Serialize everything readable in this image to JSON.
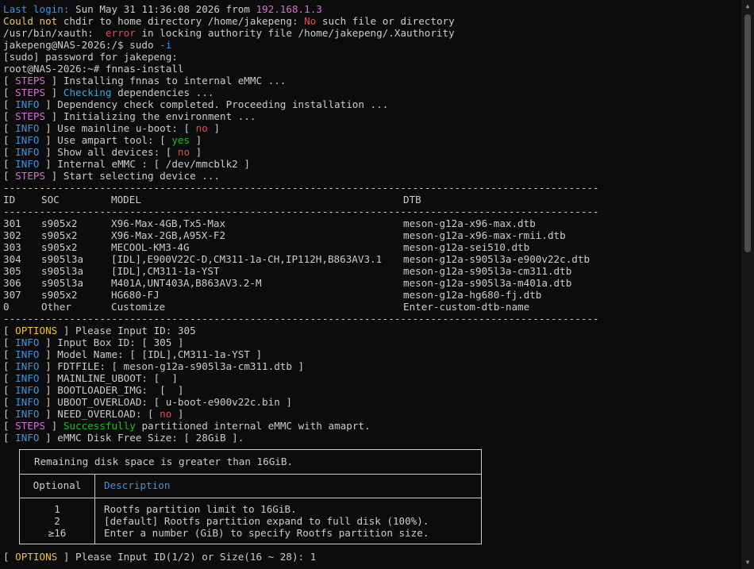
{
  "login": {
    "label": "Last login:",
    "text": " Sun May 31 11:36:08 2026 from ",
    "ip": "192.168.1.3"
  },
  "chdir": {
    "a": "Could not",
    "b": " chdir to home directory /home/jakepeng: ",
    "c": "No",
    "d": " such file or directory"
  },
  "xauth": {
    "a": "/usr/bin/xauth:  ",
    "b": "error",
    "c": " in locking authority file /home/jakepeng/.Xauthority"
  },
  "sudo_cmd": {
    "prompt": "jakepeng@NAS-2026:/$ sudo ",
    "flag": "-i"
  },
  "sudo_pw": "[sudo] password for jakepeng:",
  "root_cmd": "root@NAS-2026:~# fnnas-install",
  "log1": [
    {
      "tag": "STEPS",
      "color": "#d670d6",
      "pre": " Installing fnnas to internal eMMC ..."
    },
    {
      "tag": "STEPS",
      "color": "#d670d6",
      "hl": "Checking",
      "post": " dependencies ..."
    },
    {
      "tag": "INFO",
      "color": "#3a96dd",
      "pre": " Dependency check completed. Proceeding installation ..."
    },
    {
      "tag": "STEPS",
      "color": "#d670d6",
      "pre": " Initializing the environment ..."
    },
    {
      "tag": "INFO",
      "color": "#3a96dd",
      "pre": " Use mainline u-boot: [ ",
      "val": "no",
      "valc": "#e74856",
      "end": " ]"
    },
    {
      "tag": "INFO",
      "color": "#3a96dd",
      "pre": " Use ampart tool: [ ",
      "val": "yes",
      "valc": "#16c60c",
      "end": " ]"
    },
    {
      "tag": "INFO",
      "color": "#3a96dd",
      "pre": " Show all devices: [ ",
      "val": "no",
      "valc": "#e74856",
      "end": " ]"
    },
    {
      "tag": "INFO",
      "color": "#3a96dd",
      "pre": " Internal eMMC : [ /dev/mmcblk2 ]"
    },
    {
      "tag": "STEPS",
      "color": "#d670d6",
      "pre": " Start selecting device ..."
    }
  ],
  "dashes": "---------------------------------------------------------------------------------------------------",
  "table": {
    "headers": [
      "ID",
      "SOC",
      "MODEL",
      "DTB"
    ],
    "rows": [
      [
        "301",
        "s905x2",
        "X96-Max-4GB,Tx5-Max",
        "meson-g12a-x96-max.dtb"
      ],
      [
        "302",
        "s905x2",
        "X96-Max-2GB,A95X-F2",
        "meson-g12a-x96-max-rmii.dtb"
      ],
      [
        "303",
        "s905x2",
        "MECOOL-KM3-4G",
        "meson-g12a-sei510.dtb"
      ],
      [
        "304",
        "s905l3a",
        "[IDL],E900V22C-D,CM311-1a-CH,IP112H,B863AV3.1",
        "meson-g12a-s905l3a-e900v22c.dtb"
      ],
      [
        "305",
        "s905l3a",
        "[IDL],CM311-1a-YST",
        "meson-g12a-s905l3a-cm311.dtb"
      ],
      [
        "306",
        "s905l3a",
        "M401A,UNT403A,B863AV3.2-M",
        "meson-g12a-s905l3a-m401a.dtb"
      ],
      [
        "307",
        "s905x2",
        "HG680-FJ",
        "meson-g12a-hg680-fj.dtb"
      ],
      [
        "0",
        "Other",
        "Customize",
        "Enter-custom-dtb-name"
      ]
    ]
  },
  "log2": [
    {
      "tag": "OPTIONS",
      "color": "#f1c232",
      "pre": " Please Input ID: 305"
    },
    {
      "tag": "INFO",
      "color": "#3a96dd",
      "pre": " Input Box ID: [ 305 ]"
    },
    {
      "tag": "INFO",
      "color": "#3a96dd",
      "pre": " Model Name: [ [IDL],CM311-1a-YST ]"
    },
    {
      "tag": "INFO",
      "color": "#3a96dd",
      "pre": " FDTFILE: [ meson-g12a-s905l3a-cm311.dtb ]"
    },
    {
      "tag": "INFO",
      "color": "#3a96dd",
      "pre": " MAINLINE_UBOOT: [  ]"
    },
    {
      "tag": "INFO",
      "color": "#3a96dd",
      "pre": " BOOTLOADER_IMG:  [  ]"
    },
    {
      "tag": "INFO",
      "color": "#3a96dd",
      "pre": " UBOOT_OVERLOAD: [ u-boot-e900v22c.bin ]"
    },
    {
      "tag": "INFO",
      "color": "#3a96dd",
      "pre": " NEED_OVERLOAD: [ ",
      "val": "no",
      "valc": "#e74856",
      "end": " ]"
    },
    {
      "tag": "STEPS",
      "color": "#d670d6",
      "hlg": "Successfully",
      "post": " partitioned internal eMMC with amaprt."
    },
    {
      "tag": "INFO",
      "color": "#3a96dd",
      "pre": " eMMC Disk Free Size: [ 28GiB ]."
    }
  ],
  "box": {
    "header": "Remaining disk space is greater than 16GiB.",
    "col1": "Optional",
    "col2": "Description",
    "options": [
      {
        "n": "1",
        "d": "Rootfs partition limit to 16GiB."
      },
      {
        "n": "2",
        "d": "[default] Rootfs partition expand to full disk (100%)."
      },
      {
        "n": "≥16",
        "d": "Enter a number (GiB) to specify Rootfs partition size."
      }
    ]
  },
  "final_prompt": {
    "tag": "OPTIONS",
    "text": " Please Input ID(1/2) or Size(16 ~ 28): 1"
  }
}
